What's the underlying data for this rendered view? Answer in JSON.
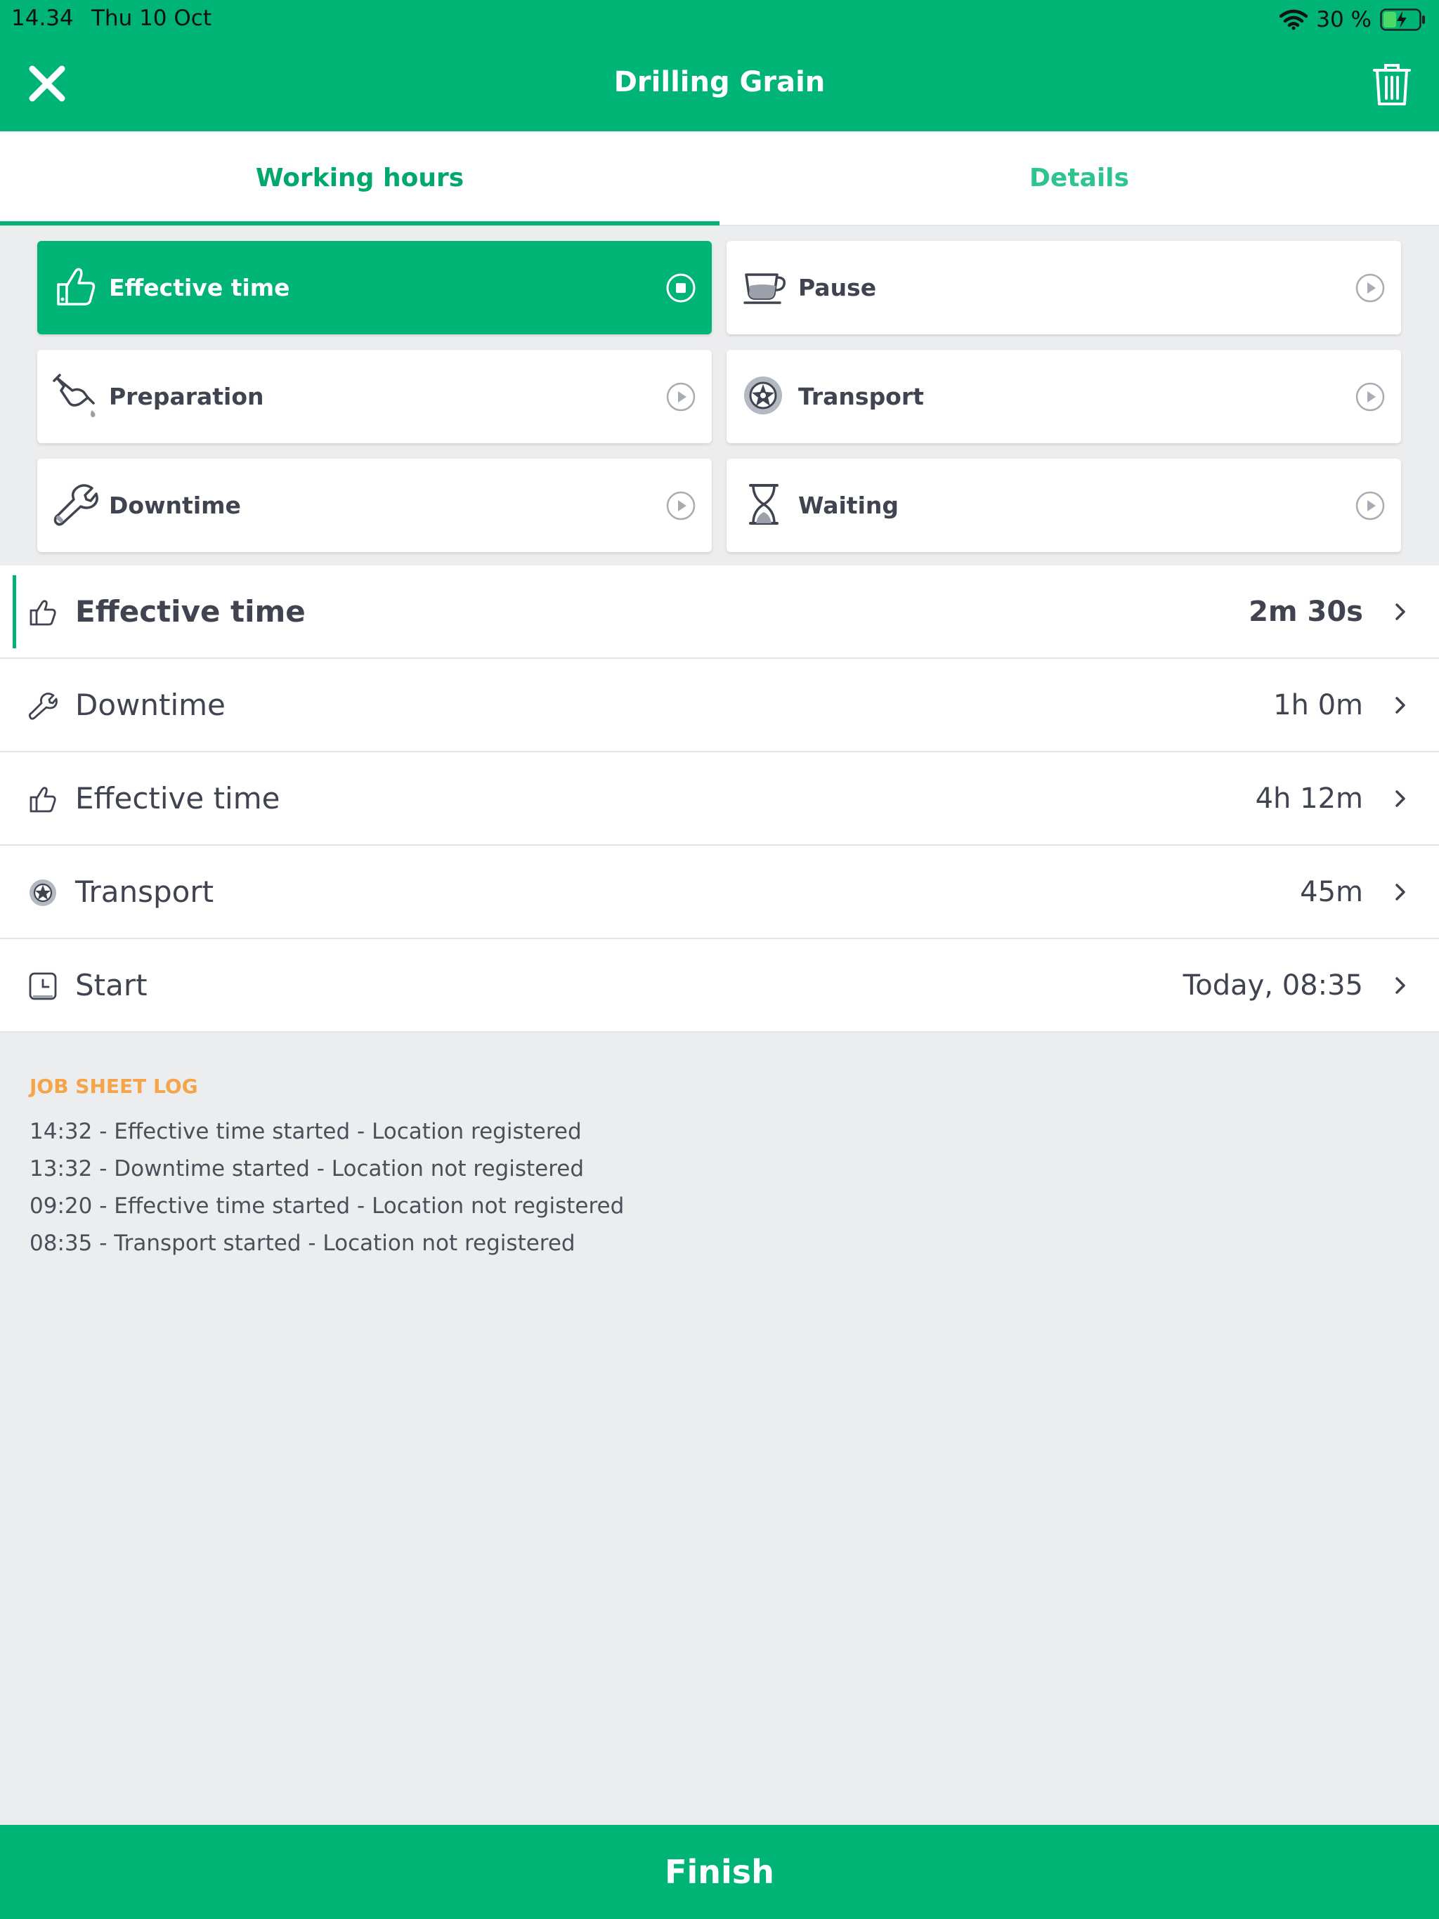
{
  "status_bar": {
    "time": "14.34",
    "date": "Thu 10 Oct",
    "battery": "30 %"
  },
  "nav": {
    "title": "Drilling Grain",
    "close_icon": "close-icon",
    "trash_icon": "trash-icon"
  },
  "tabs": [
    {
      "label": "Working hours",
      "active": true
    },
    {
      "label": "Details",
      "active": false
    }
  ],
  "activities": [
    {
      "label": "Effective time",
      "icon": "thumbs-up-icon",
      "state": "active"
    },
    {
      "label": "Pause",
      "icon": "coffee-cup-icon",
      "state": "idle"
    },
    {
      "label": "Preparation",
      "icon": "oil-can-icon",
      "state": "idle"
    },
    {
      "label": "Transport",
      "icon": "wheel-icon",
      "state": "idle"
    },
    {
      "label": "Downtime",
      "icon": "wrench-icon",
      "state": "idle"
    },
    {
      "label": "Waiting",
      "icon": "hourglass-icon",
      "state": "idle"
    }
  ],
  "entries": [
    {
      "label": "Effective time",
      "value": "2m 30s",
      "icon": "thumbs-up-icon",
      "current": true
    },
    {
      "label": "Downtime",
      "value": "1h 0m",
      "icon": "wrench-icon",
      "current": false
    },
    {
      "label": "Effective time",
      "value": "4h 12m",
      "icon": "thumbs-up-icon",
      "current": false
    },
    {
      "label": "Transport",
      "value": "45m",
      "icon": "wheel-icon",
      "current": false
    },
    {
      "label": "Start",
      "value": "Today, 08:35",
      "icon": "clock-icon",
      "current": false
    }
  ],
  "log": {
    "title": "JOB SHEET LOG",
    "lines": [
      "14:32 - Effective time started - Location registered",
      "13:32 - Downtime started - Location not registered",
      "09:20 - Effective time started - Location not registered",
      "08:35 - Transport started - Location not registered"
    ]
  },
  "finish_label": "Finish",
  "colors": {
    "brand": "#00B475",
    "log_title": "#F5A44A",
    "text": "#3F4450",
    "background": "#ECEDEF"
  }
}
